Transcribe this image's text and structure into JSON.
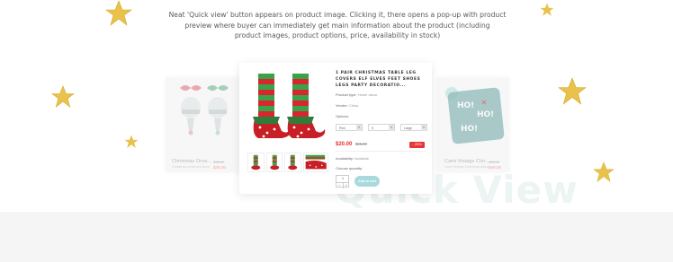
{
  "intro": {
    "line1": "Neat 'Quick view' button appears on product image. Clicking it, there opens a pop-up with product",
    "line2": "preview where buyer can immediately get main information about the product (including",
    "line3": "product images, product options, price, availability in stock)"
  },
  "watermark": "Quick View",
  "left_card": {
    "name": "Christmas Orna...",
    "sub": "Christmas ornament decor",
    "price": "$35.00",
    "old_price": "$38.00"
  },
  "right_card": {
    "name": "Cami Vintage Chri...",
    "sub": "Cami Vintage Christmas pillow",
    "price": "$48.00",
    "old_price": "$55.00"
  },
  "popup": {
    "title": "1 Pair Christmas Table Leg Covers Elf Elves Feet Shoes Legs Party Decoratio...",
    "product_type_label": "Product type:",
    "product_type": "Home decor",
    "vendor_label": "Vendor:",
    "vendor": "China",
    "options_label": "Options:",
    "options": [
      "Red",
      "S",
      "Large"
    ],
    "price": "$20.00",
    "old_price": "$25.00",
    "discount": "- 20%",
    "availability_label": "Availability:",
    "availability": "Available",
    "quantity_label": "Choose quantity:",
    "quantity": "1",
    "minus": "−",
    "plus": "+",
    "add_to_cart": "Add to cart"
  },
  "colors": {
    "accent": "#a8d9dc",
    "price": "#e0302f",
    "star": "#e8c24a"
  }
}
